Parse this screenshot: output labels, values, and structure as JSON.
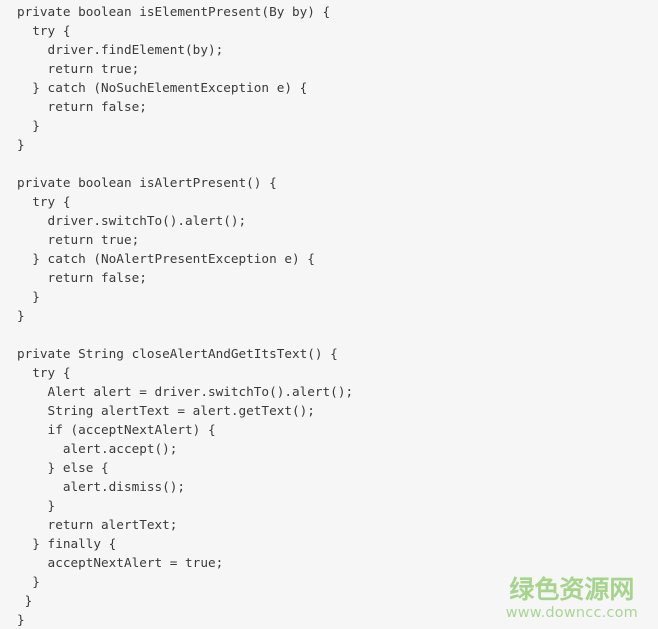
{
  "document": {
    "language": "java",
    "background_color": "#f6f6f6",
    "text_color": "#3a3a3a",
    "indent_size": 2,
    "code_lines": [
      "private boolean isElementPresent(By by) {",
      "  try {",
      "    driver.findElement(by);",
      "    return true;",
      "  } catch (NoSuchElementException e) {",
      "    return false;",
      "  }",
      "}",
      "",
      "private boolean isAlertPresent() {",
      "  try {",
      "    driver.switchTo().alert();",
      "    return true;",
      "  } catch (NoAlertPresentException e) {",
      "    return false;",
      "  }",
      "}",
      "",
      "private String closeAlertAndGetItsText() {",
      "  try {",
      "    Alert alert = driver.switchTo().alert();",
      "    String alertText = alert.getText();",
      "    if (acceptNextAlert) {",
      "      alert.accept();",
      "    } else {",
      "      alert.dismiss();",
      "    }",
      "    return alertText;",
      "  } finally {",
      "    acceptNextAlert = true;",
      "  }",
      " }",
      "}"
    ]
  },
  "watermark": {
    "brand_cn": "绿色资源网",
    "url": "www.downcc.com",
    "brand_color": "#a6d48c",
    "url_color": "#a9d694"
  }
}
